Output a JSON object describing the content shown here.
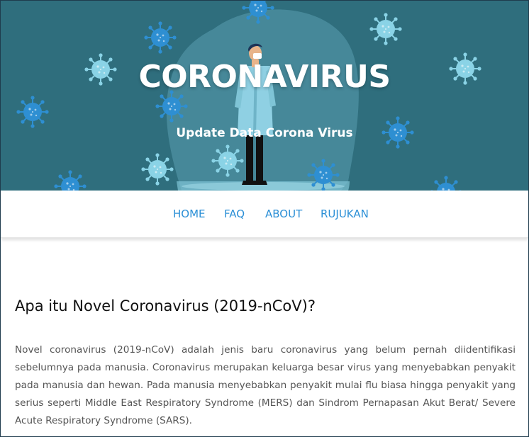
{
  "hero": {
    "title": "CORONAVIRUS",
    "subtitle": "Update Data Corona Virus",
    "background_color": "#2f6e7d",
    "illustration": "doctor-with-mask"
  },
  "nav": {
    "items": [
      {
        "label": "HOME"
      },
      {
        "label": "FAQ"
      },
      {
        "label": "ABOUT"
      },
      {
        "label": "RUJUKAN"
      }
    ],
    "link_color": "#2b8fd6"
  },
  "article": {
    "title": "Apa itu Novel Coronavirus (2019-nCoV)?",
    "body": "Novel coronavirus (2019-nCoV) adalah jenis baru coronavirus yang belum pernah diidentifikasi sebelumnya pada manusia. Coronavirus merupakan keluarga besar virus yang menyebabkan penyakit pada manusia dan hewan. Pada manusia menyebabkan penyakit mulai flu biasa hingga penyakit yang serius seperti Middle East Respiratory Syndrome (MERS) dan Sindrom Pernapasan Akut Berat/ Severe Acute Respiratory Syndrome (SARS)."
  }
}
